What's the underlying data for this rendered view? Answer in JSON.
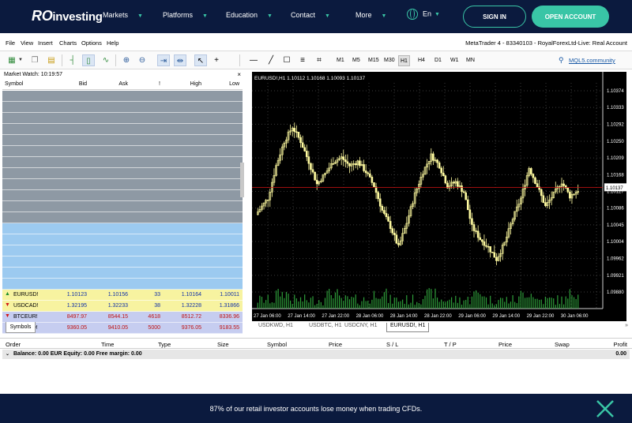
{
  "nav": {
    "logo_r": "RO",
    "logo_text": "investing",
    "items": [
      {
        "label": "Markets"
      },
      {
        "label": "Platforms"
      },
      {
        "label": "Education"
      },
      {
        "label": "Contact"
      },
      {
        "label": "More"
      }
    ],
    "lang": "En",
    "signin": "SIGN IN",
    "open_account": "OPEN ACCOUNT",
    "accent": "#39c5a6",
    "bg": "#0b1a3e"
  },
  "menu": {
    "items": [
      "File",
      "View",
      "Insert",
      "Charts",
      "Options",
      "Help"
    ],
    "title": "MetaTrader 4 - 83340103 - RoyalForexLtd-Live: Real Account"
  },
  "toolbar": {
    "timeframes": [
      "M1",
      "M5",
      "M15",
      "M30",
      "H1",
      "H4",
      "D1",
      "W1",
      "MN"
    ],
    "active_timeframe": "H1",
    "mql5": "MQL5.community"
  },
  "market_watch": {
    "title": "Market Watch: 10:19:57",
    "columns": {
      "symbol": "Symbol",
      "bid": "Bid",
      "ask": "Ask",
      "spread": "!",
      "high": "High",
      "low": "Low"
    },
    "rows": [
      {
        "symbol": "EURUSD!",
        "bid": "1.10123",
        "ask": "1.10156",
        "spread": "33",
        "high": "1.10164",
        "low": "1.10011",
        "dir": "up",
        "style": "yellow"
      },
      {
        "symbol": "USDCAD!",
        "bid": "1.32195",
        "ask": "1.32233",
        "spread": "38",
        "high": "1.32228",
        "low": "1.31866",
        "dir": "down",
        "style": "yellow"
      },
      {
        "symbol": "BTCEUR!",
        "bid": "8497.97",
        "ask": "8544.15",
        "spread": "4618",
        "high": "8512.72",
        "low": "8336.96",
        "dir": "down",
        "style": "purple"
      },
      {
        "symbol": "BTCUSD!",
        "bid": "9360.05",
        "ask": "9410.05",
        "spread": "5000",
        "high": "9376.05",
        "low": "9183.55",
        "dir": "down",
        "style": "purple"
      }
    ],
    "tab": "Symbols"
  },
  "chart": {
    "header": "EURUSD!,H1 1.10112 1.10168 1.10093 1.10137",
    "current_price": "1.10137",
    "y_ticks": [
      "1.10374",
      "1.10333",
      "1.10292",
      "1.10250",
      "1.10209",
      "1.10168",
      "1.10127",
      "1.10086",
      "1.10045",
      "1.10004",
      "1.09962",
      "1.09921",
      "1.09880"
    ],
    "x_ticks": [
      "27 Jan 06:00",
      "27 Jan 14:00",
      "27 Jan 22:00",
      "28 Jan 06:00",
      "28 Jan 14:00",
      "28 Jan 22:00",
      "29 Jan 06:00",
      "29 Jan 14:00",
      "29 Jan 22:00",
      "30 Jan 06:00"
    ],
    "tabs": [
      "USDKWD, H1",
      "USDBTC, H1",
      "USDCNY, H1",
      "EURUSD!, H1"
    ],
    "active_tab": "EURUSD!, H1",
    "candle_color": "#fffba0",
    "volume_color": "#2e9e3a",
    "price_line_color": "#d11414"
  },
  "terminal": {
    "columns": [
      "Order",
      "Time",
      "Type",
      "Size",
      "Symbol",
      "Price",
      "S / L",
      "T / P",
      "Price",
      "Swap",
      "Profit"
    ],
    "balance": "Balance: 0.00 EUR  Equity: 0.00  Free margin: 0.00",
    "profit": "0.00"
  },
  "banner": {
    "text": "87% of our retail investor accounts lose money when trading CFDs."
  }
}
